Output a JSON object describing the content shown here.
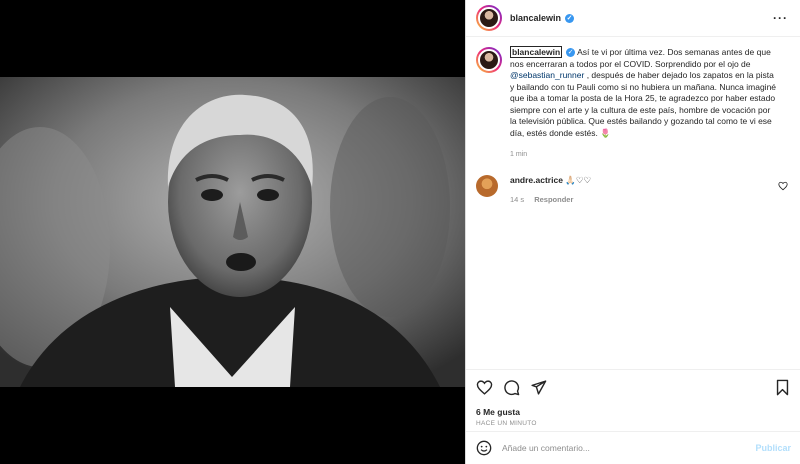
{
  "post": {
    "username": "blancalewin",
    "caption_username": "blancalewin",
    "caption_text": "Así te vi por última vez. Dos semanas antes de que nos encerraran a todos por el COVID. Sorprendido por el ojo de ",
    "mention": "@sebastian_runner",
    "caption_rest": " , después de haber dejado los zapatos en la pista y bailando con tu Pauli como si no hubiera un mañana. Nunca imaginé que iba a tomar la posta de la Hora 25, te agradezco por haber estado siempre con el arte y la cultura de este país, hombre de vocación por la televisión pública. Que estés bailando y gozando tal como te vi ese día, estés donde estés. 🌷",
    "caption_time": "1 min"
  },
  "comment": {
    "username": "andre.actrice",
    "text": " 🙏🏻♡♡",
    "time": "14 s",
    "reply": "Responder"
  },
  "stats": {
    "likes": "6 Me gusta",
    "ago": "HACE UN MINUTO"
  },
  "composer": {
    "placeholder": "Añade un comentario...",
    "publish": "Publicar"
  },
  "icons": {
    "more": "more-icon",
    "heart": "heart-icon",
    "comment": "comment-icon",
    "share": "share-icon",
    "save": "bookmark-icon",
    "emoji": "emoji-icon"
  }
}
